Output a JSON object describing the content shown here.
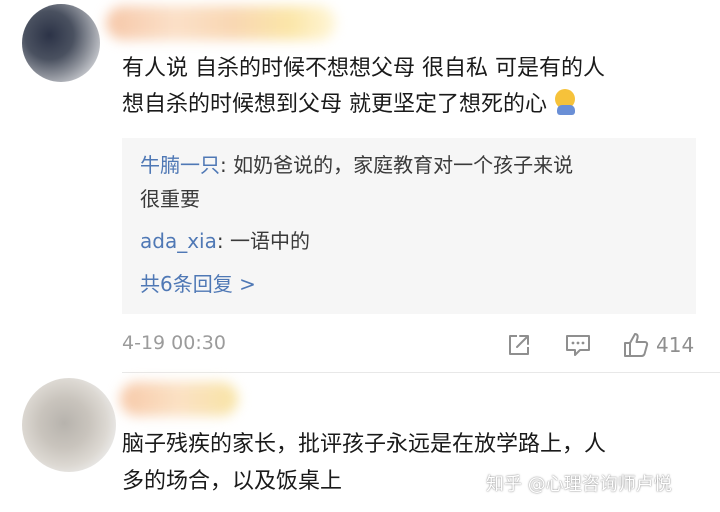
{
  "comments": [
    {
      "lines": [
        "有人说 自杀的时候不想想父母 很自私 可是有的人",
        "想自杀的时候想到父母 就更坚定了想死的心"
      ],
      "emoji": "sad-face-emoji",
      "replies": [
        {
          "user": "牛腩一只",
          "text": ": 如奶爸说的，家庭教育对一个孩子来说",
          "continuation": "很重要"
        },
        {
          "user": "ada_xia",
          "text": ": 一语中的"
        }
      ],
      "more_replies": "共6条回复 >",
      "timestamp": "4-19 00:30",
      "likes": "414"
    },
    {
      "lines": [
        "脑子残疾的家长，批评孩子永远是在放学路上，人",
        "多的场合，以及饭桌上"
      ]
    }
  ],
  "watermark": "知乎 @心理咨询师卢悦",
  "colors": {
    "link": "#4f78b5",
    "reply_bg": "#f6f6f6",
    "meta": "#9b9b9b"
  }
}
